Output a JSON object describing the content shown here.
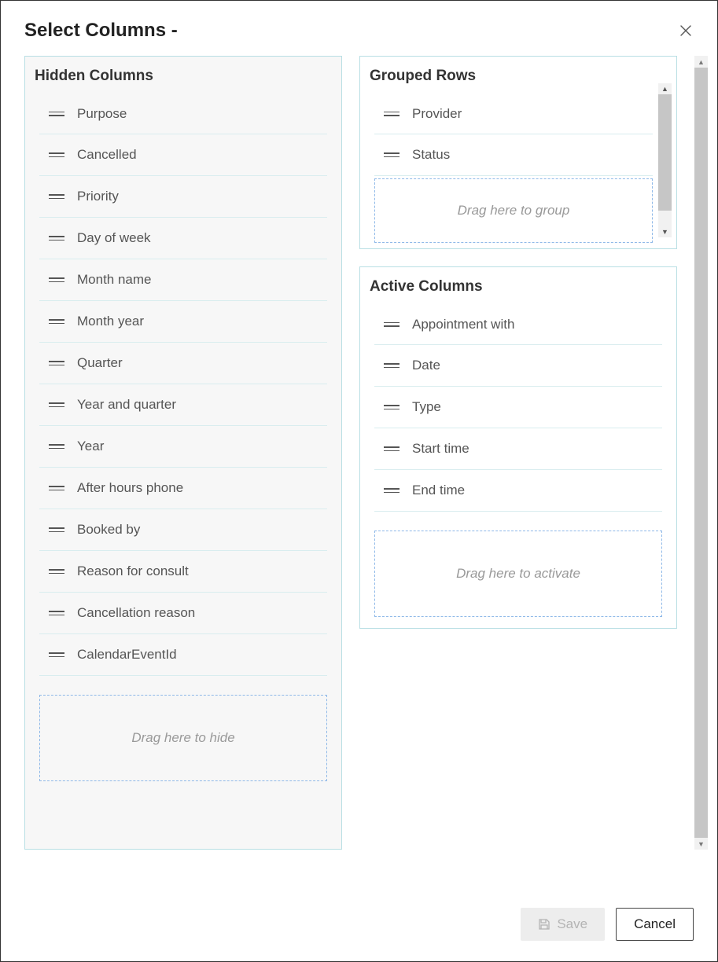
{
  "dialog": {
    "title": "Select Columns -"
  },
  "hidden": {
    "title": "Hidden Columns",
    "drop_text": "Drag here to hide",
    "items": [
      "Purpose",
      "Cancelled",
      "Priority",
      "Day of week",
      "Month name",
      "Month year",
      "Quarter",
      "Year and quarter",
      "Year",
      "After hours phone",
      "Booked by",
      "Reason for consult",
      "Cancellation reason",
      "CalendarEventId"
    ]
  },
  "grouped": {
    "title": "Grouped Rows",
    "drop_text": "Drag here to group",
    "items": [
      "Provider",
      "Status"
    ]
  },
  "active": {
    "title": "Active Columns",
    "drop_text": "Drag here to activate",
    "items": [
      "Appointment with",
      "Date",
      "Type",
      "Start time",
      "End time"
    ]
  },
  "footer": {
    "save": "Save",
    "cancel": "Cancel"
  }
}
